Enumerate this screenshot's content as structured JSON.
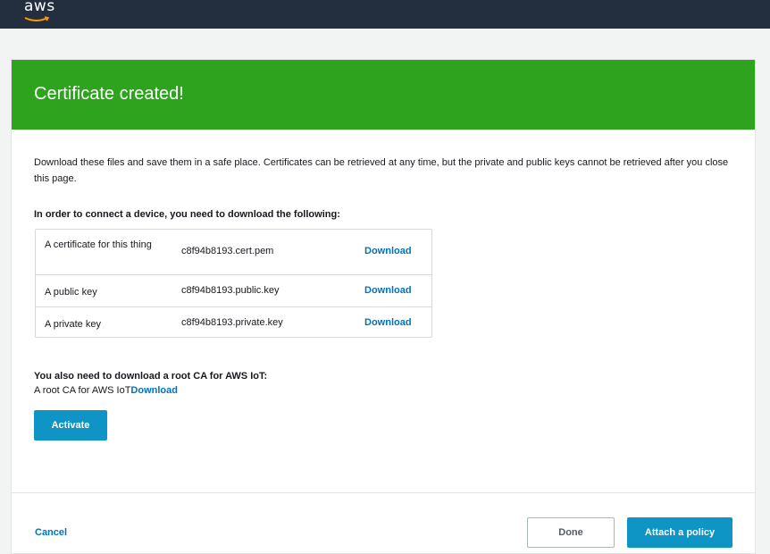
{
  "topbar": {
    "logo_text": "aws"
  },
  "header": {
    "title": "Certificate created!"
  },
  "intro": "Download these files and save them in a safe place. Certificates can be retrieved at any time, but the private and public keys cannot be retrieved after you close this page.",
  "files_section": {
    "title": "In order to connect a device, you need to download the following:",
    "rows": [
      {
        "label": "A certificate for this thing",
        "file": "c8f94b8193.cert.pem",
        "action": "Download"
      },
      {
        "label": "A public key",
        "file": "c8f94b8193.public.key",
        "action": "Download"
      },
      {
        "label": "A private key",
        "file": "c8f94b8193.private.key",
        "action": "Download"
      }
    ]
  },
  "root_ca": {
    "title": "You also need to download a root CA for AWS IoT:",
    "text": "A root CA for AWS IoT",
    "link": "Download"
  },
  "buttons": {
    "activate": "Activate",
    "cancel": "Cancel",
    "done": "Done",
    "attach_policy": "Attach a policy"
  },
  "colors": {
    "topbar": "#232f3e",
    "success_header": "#2ea31e",
    "primary_button": "#0f94c6",
    "link": "#0073bb"
  }
}
